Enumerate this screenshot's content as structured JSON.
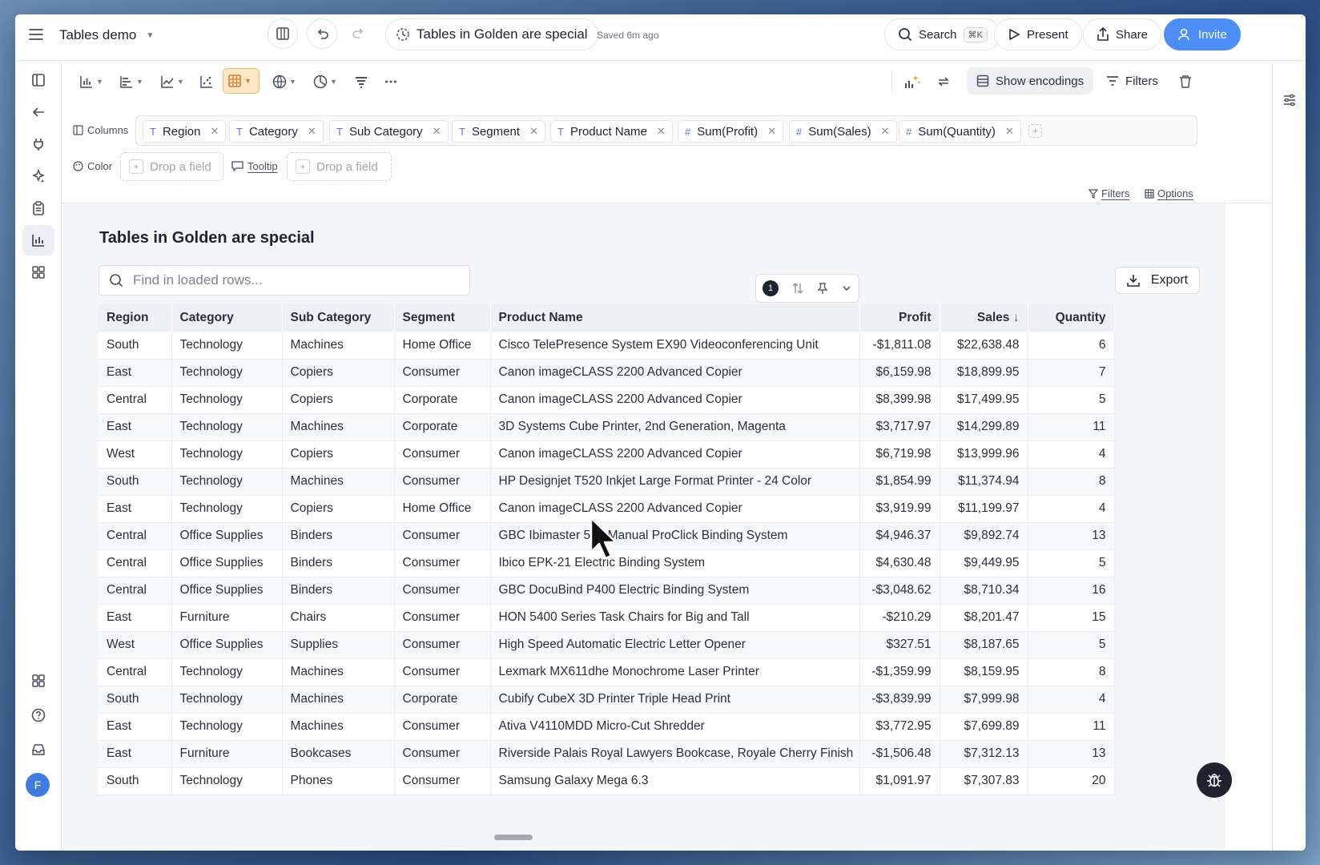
{
  "app": {
    "title": "Tables demo",
    "doc_title": "Tables in Golden are special",
    "saved_status": "Saved 6m ago"
  },
  "topbar": {
    "search_label": "Search",
    "search_shortcut": "⌘K",
    "present_label": "Present",
    "share_label": "Share",
    "invite_label": "Invite"
  },
  "toolbar": {
    "show_encodings_label": "Show encodings",
    "filters_label": "Filters"
  },
  "encodings": {
    "columns_label": "Columns",
    "color_label": "Color",
    "tooltip_label": "Tooltip",
    "drop_placeholder": "Drop a field",
    "filters_link": "Filters",
    "options_link": "Options",
    "columns": [
      {
        "type": "T",
        "name": "Region"
      },
      {
        "type": "T",
        "name": "Category"
      },
      {
        "type": "T",
        "name": "Sub Category"
      },
      {
        "type": "T",
        "name": "Segment"
      },
      {
        "type": "T",
        "name": "Product Name"
      },
      {
        "type": "#",
        "name": "Sum(Profit)"
      },
      {
        "type": "#",
        "name": "Sum(Sales)"
      },
      {
        "type": "#",
        "name": "Sum(Quantity)"
      }
    ]
  },
  "table": {
    "title": "Tables in Golden are special",
    "search_placeholder": "Find in loaded rows...",
    "sort_count": "1",
    "export_label": "Export",
    "headers": [
      "Region",
      "Category",
      "Sub Category",
      "Segment",
      "Product Name",
      "Profit",
      "Sales",
      "Quantity"
    ],
    "sorted_column": "Sales",
    "sort_direction": "descending",
    "rows": [
      [
        "South",
        "Technology",
        "Machines",
        "Home Office",
        "Cisco TelePresence System EX90 Videoconferencing Unit",
        "-$1,811.08",
        "$22,638.48",
        "6"
      ],
      [
        "East",
        "Technology",
        "Copiers",
        "Consumer",
        "Canon imageCLASS 2200 Advanced Copier",
        "$6,159.98",
        "$18,899.95",
        "7"
      ],
      [
        "Central",
        "Technology",
        "Copiers",
        "Corporate",
        "Canon imageCLASS 2200 Advanced Copier",
        "$8,399.98",
        "$17,499.95",
        "5"
      ],
      [
        "East",
        "Technology",
        "Machines",
        "Corporate",
        "3D Systems Cube Printer, 2nd Generation, Magenta",
        "$3,717.97",
        "$14,299.89",
        "11"
      ],
      [
        "West",
        "Technology",
        "Copiers",
        "Consumer",
        "Canon imageCLASS 2200 Advanced Copier",
        "$6,719.98",
        "$13,999.96",
        "4"
      ],
      [
        "South",
        "Technology",
        "Machines",
        "Consumer",
        "HP Designjet T520 Inkjet Large Format Printer - 24 Color",
        "$1,854.99",
        "$11,374.94",
        "8"
      ],
      [
        "East",
        "Technology",
        "Copiers",
        "Home Office",
        "Canon imageCLASS 2200 Advanced Copier",
        "$3,919.99",
        "$11,199.97",
        "4"
      ],
      [
        "Central",
        "Office Supplies",
        "Binders",
        "Consumer",
        "GBC Ibimaster 500 Manual ProClick Binding System",
        "$4,946.37",
        "$9,892.74",
        "13"
      ],
      [
        "Central",
        "Office Supplies",
        "Binders",
        "Consumer",
        "Ibico EPK-21 Electric Binding System",
        "$4,630.48",
        "$9,449.95",
        "5"
      ],
      [
        "Central",
        "Office Supplies",
        "Binders",
        "Consumer",
        "GBC DocuBind P400 Electric Binding System",
        "-$3,048.62",
        "$8,710.34",
        "16"
      ],
      [
        "East",
        "Furniture",
        "Chairs",
        "Consumer",
        "HON 5400 Series Task Chairs for Big and Tall",
        "-$210.29",
        "$8,201.47",
        "15"
      ],
      [
        "West",
        "Office Supplies",
        "Supplies",
        "Consumer",
        "High Speed Automatic Electric Letter Opener",
        "$327.51",
        "$8,187.65",
        "5"
      ],
      [
        "Central",
        "Technology",
        "Machines",
        "Consumer",
        "Lexmark MX611dhe Monochrome Laser Printer",
        "-$1,359.99",
        "$8,159.95",
        "8"
      ],
      [
        "South",
        "Technology",
        "Machines",
        "Corporate",
        "Cubify CubeX 3D Printer Triple Head Print",
        "-$3,839.99",
        "$7,999.98",
        "4"
      ],
      [
        "East",
        "Technology",
        "Machines",
        "Consumer",
        "Ativa V4110MDD Micro-Cut Shredder",
        "$3,772.95",
        "$7,699.89",
        "11"
      ],
      [
        "East",
        "Furniture",
        "Bookcases",
        "Consumer",
        "Riverside Palais Royal Lawyers Bookcase, Royale Cherry Finish",
        "-$1,506.48",
        "$7,312.13",
        "13"
      ],
      [
        "South",
        "Technology",
        "Phones",
        "Consumer",
        "Samsung Galaxy Mega 6.3",
        "$1,091.97",
        "$7,307.83",
        "20"
      ]
    ]
  },
  "user": {
    "avatar_initial": "F"
  },
  "colors": {
    "accent": "#4c8df6",
    "active_tool_bg": "#fde7c9",
    "active_tool_border": "#f4b667"
  }
}
